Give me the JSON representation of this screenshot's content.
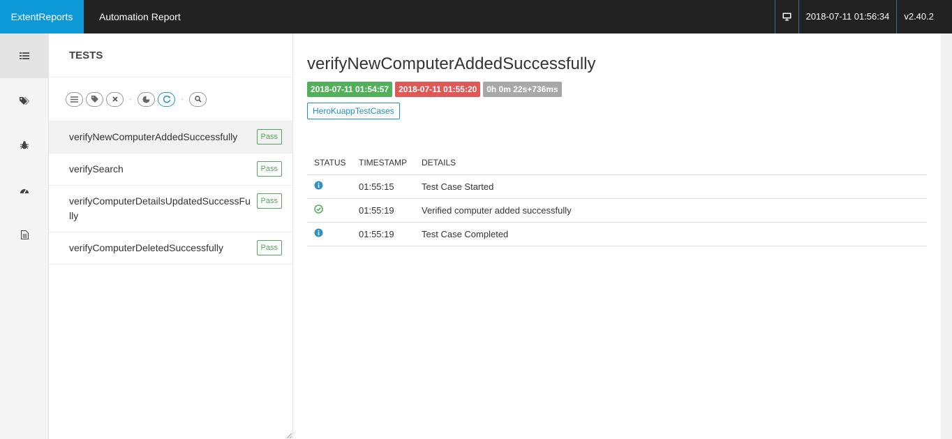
{
  "header": {
    "brand": "ExtentReports",
    "report_name": "Automation Report",
    "timestamp": "2018-07-11 01:56:34",
    "version": "v2.40.2",
    "icon": "monitor-icon"
  },
  "nav": {
    "items": [
      {
        "icon": "list-view-icon",
        "active": true
      },
      {
        "icon": "tags-icon",
        "active": false
      },
      {
        "icon": "bug-icon",
        "active": false
      },
      {
        "icon": "dashboard-icon",
        "active": false
      },
      {
        "icon": "document-icon",
        "active": false
      }
    ]
  },
  "tests_panel": {
    "title": "TESTS",
    "filters": [
      "list-icon",
      "tag-icon",
      "close-icon",
      "pie-chart-icon",
      "refresh-icon",
      "search-icon"
    ],
    "tests": [
      {
        "name": "verifyNewComputerAddedSuccessfully",
        "status": "Pass"
      },
      {
        "name": "verifySearch",
        "status": "Pass"
      },
      {
        "name": "verifyComputerDetailsUpdatedSuccessFully",
        "name_display": "verifyComputerDetailsUpdatedSuccess\nFully",
        "status": "Pass"
      },
      {
        "name": "verifyComputerDeletedSuccessfully",
        "status": "Pass"
      }
    ]
  },
  "detail": {
    "title": "verifyNewComputerAddedSuccessfully",
    "start_time": "2018-07-11 01:54:57",
    "end_time": "2018-07-11 01:55:20",
    "duration": "0h 0m 22s+736ms",
    "category": "HeroKuappTestCases",
    "log": {
      "headers": [
        "STATUS",
        "TIMESTAMP",
        "DETAILS"
      ],
      "rows": [
        {
          "status_icon": "info-icon",
          "timestamp": "01:55:15",
          "details": "Test Case Started"
        },
        {
          "status_icon": "pass-check-icon",
          "timestamp": "01:55:19",
          "details": "Verified computer added successfully"
        },
        {
          "status_icon": "info-icon",
          "timestamp": "01:55:19",
          "details": "Test Case Completed"
        }
      ]
    }
  },
  "colors": {
    "brand": "#0d98d8",
    "topbar": "#222222",
    "pass": "#52b05b",
    "fail": "#e05757",
    "info": "#2f8fc6"
  }
}
